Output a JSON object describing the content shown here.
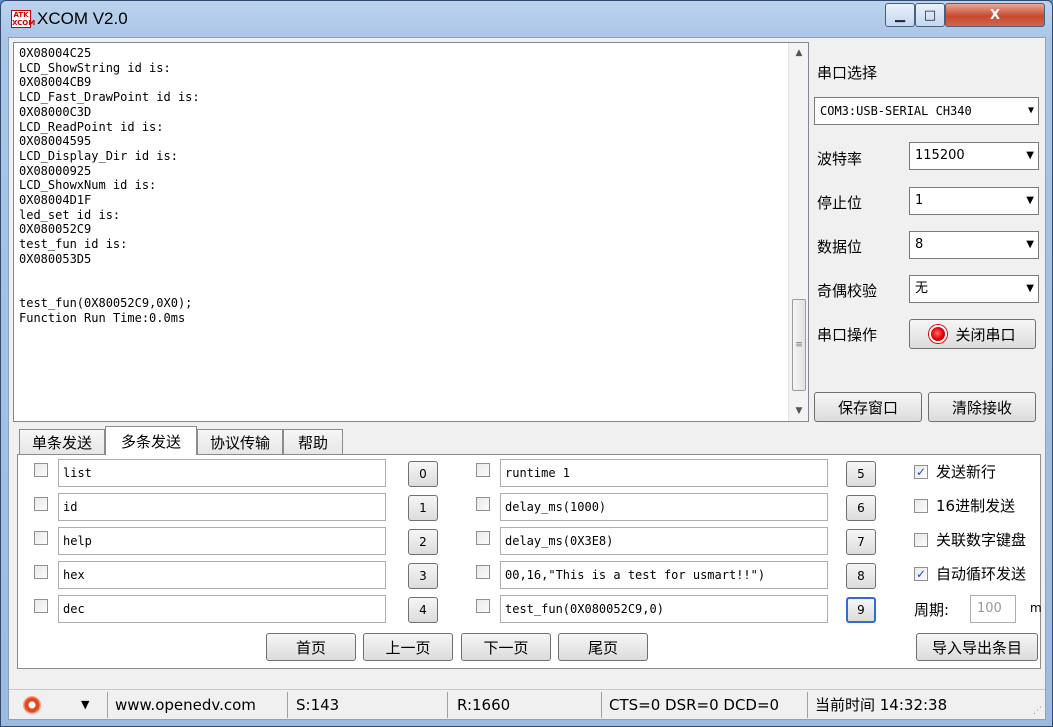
{
  "window": {
    "title": "XCOM V2.0",
    "icon_text_top": "ATK",
    "icon_text_bottom": "XCOM",
    "minimize_glyph": "▁",
    "maximize_glyph": "□",
    "close_glyph": "X"
  },
  "receive": {
    "text": "0X08004C25\nLCD_ShowString id is:\n0X08004CB9\nLCD_Fast_DrawPoint id is:\n0X08000C3D\nLCD_ReadPoint id is:\n0X08004595\nLCD_Display_Dir id is:\n0X08000925\nLCD_ShowxNum id is:\n0X08004D1F\nled_set id is:\n0X080052C9\ntest_fun id is:\n0X080053D5\n\n\ntest_fun(0X80052C9,0X0);\nFunction Run Time:0.0ms",
    "scroll_up_glyph": "▲",
    "scroll_down_glyph": "▼",
    "thumb_grip_glyph": "≡"
  },
  "side": {
    "port_label": "串口选择",
    "port_value": "COM3:USB-SERIAL CH340",
    "baud_label": "波特率",
    "baud_value": "115200",
    "stop_label": "停止位",
    "stop_value": "1",
    "data_label": "数据位",
    "data_value": "8",
    "parity_label": "奇偶校验",
    "parity_value": "无",
    "op_label": "串口操作",
    "close_port_label": "关闭串口",
    "save_window_label": "保存窗口",
    "clear_recv_label": "清除接收",
    "dropdown_glyph": "▼"
  },
  "tabs": [
    "单条发送",
    "多条发送",
    "协议传输",
    "帮助"
  ],
  "multi_send": {
    "left": [
      {
        "text": "list",
        "btn": "0"
      },
      {
        "text": "id",
        "btn": "1"
      },
      {
        "text": "help",
        "btn": "2"
      },
      {
        "text": "hex",
        "btn": "3"
      },
      {
        "text": "dec",
        "btn": "4"
      }
    ],
    "right": [
      {
        "text": "runtime 1",
        "btn": "5"
      },
      {
        "text": "delay_ms(1000)",
        "btn": "6"
      },
      {
        "text": "delay_ms(0X3E8)",
        "btn": "7"
      },
      {
        "text": "00,16,\"This is a test for usmart!!\")",
        "btn": "8"
      },
      {
        "text": "test_fun(0X080052C9,0)",
        "btn": "9"
      }
    ],
    "options": {
      "send_newline": "发送新行",
      "hex_send": "16进制发送",
      "link_numpad": "关联数字键盘",
      "auto_loop": "自动循环发送",
      "period_label": "周期:",
      "period_value": "100",
      "period_unit": "m"
    },
    "check_glyph": "✓",
    "first_page": "首页",
    "prev_page": "上一页",
    "next_page": "下一页",
    "last_page": "尾页",
    "import_export": "导入导出条目"
  },
  "status": {
    "url": "www.openedv.com",
    "sent": "S:143",
    "received": "R:1660",
    "signals": "CTS=0 DSR=0 DCD=0",
    "time": "当前时间 14:32:38",
    "dropdown_glyph": "▼",
    "grip_glyph": "⋰"
  }
}
